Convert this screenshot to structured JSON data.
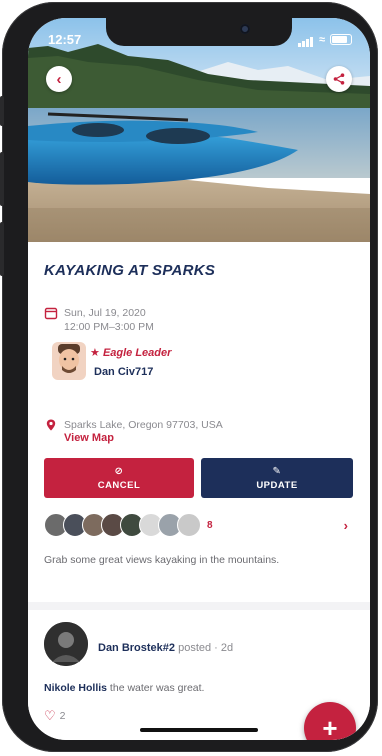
{
  "status": {
    "time": "12:57"
  },
  "event": {
    "title": "KAYAKING AT SPARKS",
    "date": "Sun, Jul 19, 2020",
    "time": "12:00 PM–3:00 PM",
    "leader_role": "Eagle Leader",
    "leader_name": "Dan Civ717",
    "location": "Sparks Lake, Oregon 97703, USA",
    "view_map": "View Map",
    "description": "Grab some great views kayaking in the mountains."
  },
  "actions": {
    "cancel": "CANCEL",
    "update": "UPDATE"
  },
  "attendees": {
    "count": "8",
    "avatar_colors": [
      "#6b6b6b",
      "#4a4f5a",
      "#7d6b5e",
      "#5a4a45",
      "#3f4a3f",
      "#d9d9d9",
      "#9aa2aa",
      "#c9c9c9"
    ]
  },
  "post": {
    "author": "Dan Brostek#2",
    "meta": " posted · 2d",
    "commenter": "Nikole Hollis",
    "comment": " the water was great.",
    "likes": "2"
  },
  "colors": {
    "accent": "#c4223f",
    "navy": "#1d2f5a"
  },
  "icons": {
    "back": "chevron-left-icon",
    "share": "share-icon",
    "calendar": "calendar-icon",
    "star": "star-icon",
    "pin": "map-pin-icon",
    "cancel": "ban-icon",
    "update": "pencil-icon",
    "chevron": "chevron-right-icon",
    "heart": "heart-icon",
    "add": "plus-icon"
  }
}
